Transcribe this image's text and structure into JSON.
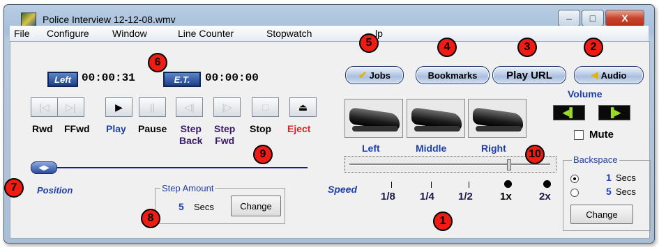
{
  "window": {
    "title": "Police Interview 12-12-08.wmv",
    "controls": {
      "minimize": "–",
      "maximize": "□",
      "close": "X"
    }
  },
  "menu": [
    "File",
    "Configure",
    "Window",
    "Line Counter",
    "Stopwatch",
    "Help"
  ],
  "menu_partial": "lp",
  "counters": {
    "left_tag": "Left",
    "left_time": "00:00:31",
    "et_tag": "E.T.",
    "et_time": "00:00:00"
  },
  "top_buttons": {
    "jobs": "Jobs",
    "bookmarks": "Bookmarks",
    "play_url": "Play URL",
    "audio": "Audio"
  },
  "volume": {
    "label": "Volume",
    "mute": "Mute"
  },
  "transport": {
    "labels": [
      "Rwd",
      "FFwd",
      "Play",
      "Pause",
      "Step\nBack",
      "Step\nFwd",
      "Stop",
      "Eject"
    ],
    "icons": [
      "|◁",
      "▷|",
      "▶",
      "||",
      "◁|",
      "|▷",
      "□",
      "⏏"
    ]
  },
  "pedals": [
    "Left",
    "Middle",
    "Right"
  ],
  "position_label": "Position",
  "speed": {
    "label": "Speed",
    "marks": [
      "1/8",
      "1/4",
      "1/2",
      "1x",
      "2x"
    ]
  },
  "step_amount": {
    "legend": "Step Amount",
    "value": "5",
    "unit": "Secs",
    "button": "Change"
  },
  "backspace": {
    "legend": "Backspace",
    "options": [
      {
        "value": "1",
        "unit": "Secs",
        "selected": true
      },
      {
        "value": "5",
        "unit": "Secs",
        "selected": false
      }
    ],
    "button": "Change"
  },
  "callouts": [
    "1",
    "2",
    "3",
    "4",
    "5",
    "6",
    "7",
    "8",
    "9",
    "10"
  ],
  "colors": {
    "accent_blue": "#1f3fa8",
    "eject_red": "#e02020",
    "callout_red": "#ee1c12",
    "volume_green": "#9edc2a"
  }
}
